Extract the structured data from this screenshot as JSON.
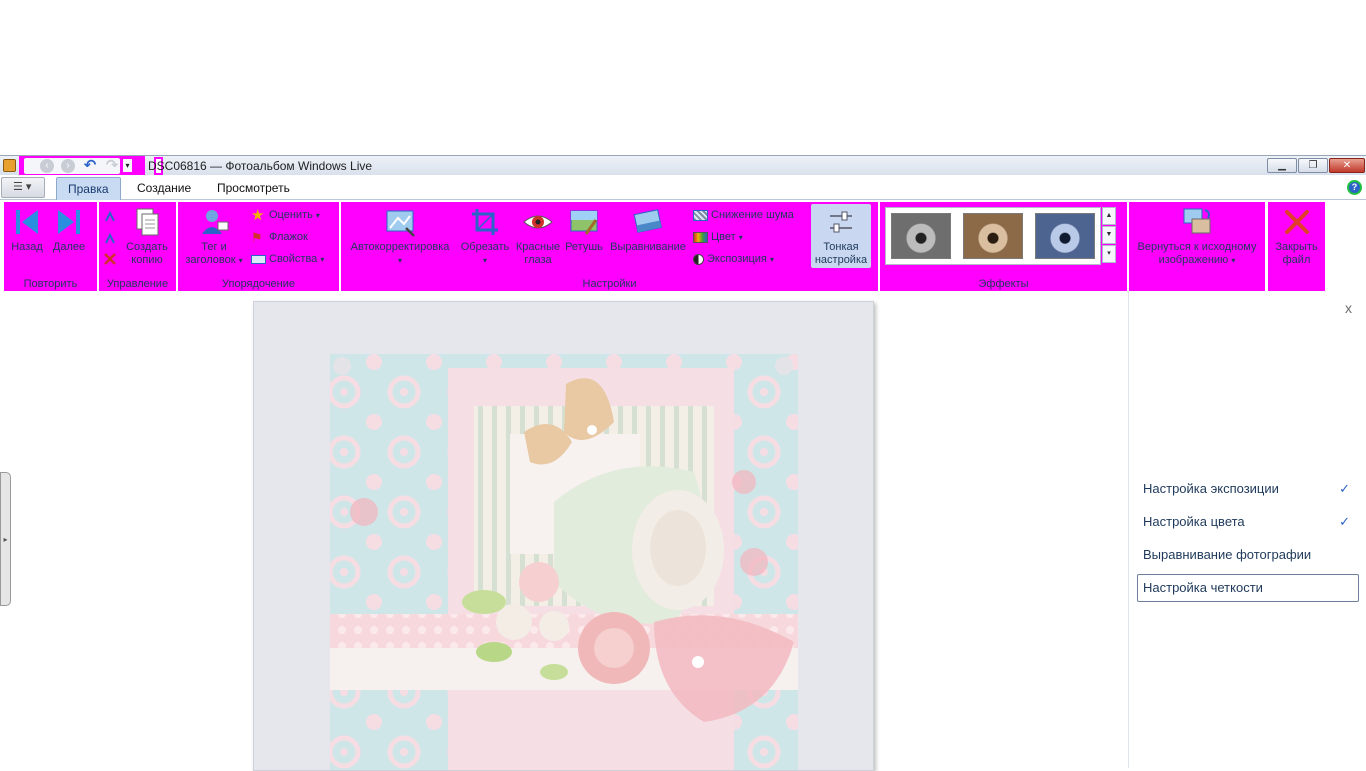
{
  "window": {
    "title": "DSC06816 — Фотоальбом Windows Live",
    "minimize": "▁",
    "maximize": "❐",
    "close": "✕"
  },
  "tabs": [
    {
      "label": "Правка",
      "active": true
    },
    {
      "label": "Создание",
      "active": false
    },
    {
      "label": "Просмотреть",
      "active": false
    }
  ],
  "ribbon": {
    "groups": {
      "repeat": "Повторить",
      "manage": "Управление",
      "organize": "Упорядочение",
      "settings": "Настройки",
      "effects": "Эффекты"
    },
    "buttons": {
      "back": "Назад",
      "next": "Далее",
      "create_copy": "Создать копию",
      "tag_title": "Тег и заголовок",
      "rate": "Оценить",
      "flag": "Флажок",
      "properties": "Свойства",
      "autocorrect": "Автокорректировка",
      "crop": "Обрезать",
      "red_eye": "Красные глаза",
      "retouch": "Ретушь",
      "straighten": "Выравнивание",
      "noise_reduction": "Снижение шума",
      "color": "Цвет",
      "exposure": "Экспозиция",
      "fine_tune": "Тонкая настройка",
      "revert": "Вернуться к исходному изображению",
      "close_file": "Закрыть файл"
    }
  },
  "side_panel": {
    "close": "x",
    "items": [
      {
        "label": "Настройка экспозиции",
        "checked": true
      },
      {
        "label": "Настройка цвета",
        "checked": true
      },
      {
        "label": "Выравнивание фотографии",
        "checked": false
      },
      {
        "label": "Настройка четкости",
        "checked": false
      }
    ],
    "check_glyph": "✓"
  },
  "colors": {
    "highlight": "#ff00ff",
    "text_blue": "#1e395b",
    "accent": "#2b63c8"
  }
}
